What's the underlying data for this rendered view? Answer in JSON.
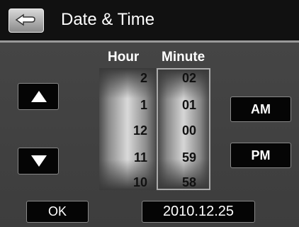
{
  "header": {
    "title": "Date & Time",
    "back_icon": "back-arrow-icon"
  },
  "columns": {
    "hour_label": "Hour",
    "minute_label": "Minute"
  },
  "hour_wheel": [
    "2",
    "1",
    "12",
    "11",
    "10"
  ],
  "minute_wheel": [
    "02",
    "01",
    "00",
    "59",
    "58"
  ],
  "buttons": {
    "am": "AM",
    "pm": "PM",
    "ok": "OK",
    "date": "2010.12.25",
    "up_icon": "triangle-up-icon",
    "down_icon": "triangle-down-icon"
  }
}
